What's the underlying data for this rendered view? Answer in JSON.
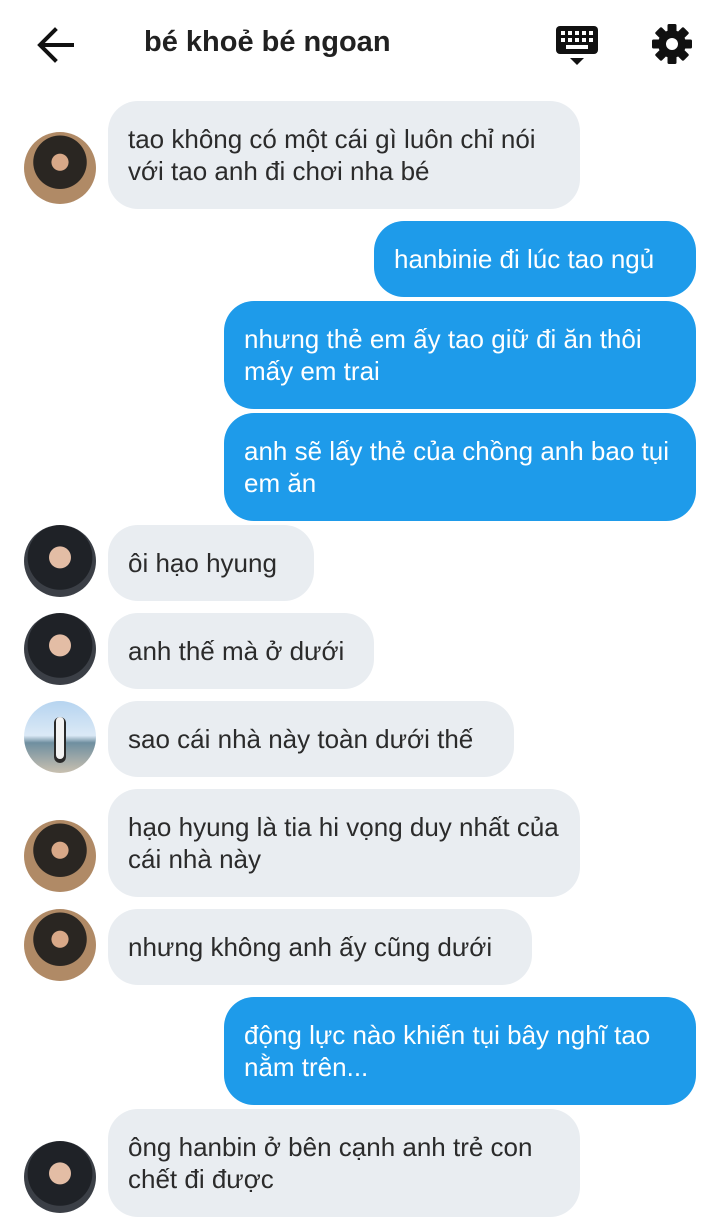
{
  "header": {
    "title": "bé khoẻ bé ngoan"
  },
  "messages": [
    {
      "side": "in",
      "text": "tao không có một cái gì luôn chỉ nói với tao anh đi chơi nha bé"
    },
    {
      "side": "out",
      "text": "hanbinie đi lúc tao ngủ"
    },
    {
      "side": "out",
      "text": "nhưng thẻ em ấy tao giữ đi ăn thôi mấy em trai"
    },
    {
      "side": "out",
      "text": "anh sẽ lấy thẻ của chồng anh bao tụi em ăn"
    },
    {
      "side": "in",
      "text": "ôi hạo hyung"
    },
    {
      "side": "in",
      "text": "anh thế mà ở dưới"
    },
    {
      "side": "in",
      "text": "sao cái nhà này toàn dưới thế"
    },
    {
      "side": "in",
      "text": "hạo hyung là tia hi vọng duy nhất của cái nhà này"
    },
    {
      "side": "in",
      "text": "nhưng không anh ấy cũng dưới"
    },
    {
      "side": "out",
      "text": "động lực nào khiến tụi bây nghĩ tao nằm trên..."
    },
    {
      "side": "in",
      "text": "ông hanbin ở bên cạnh anh trẻ con chết đi được"
    }
  ],
  "colors": {
    "incoming_bubble": "#e9edf1",
    "outgoing_bubble": "#1e9bea",
    "incoming_text": "#2b2b2b",
    "outgoing_text": "#ffffff"
  },
  "icons": {
    "back": "arrow-left-icon",
    "keyboard": "keyboard-icon",
    "settings": "gear-icon"
  }
}
